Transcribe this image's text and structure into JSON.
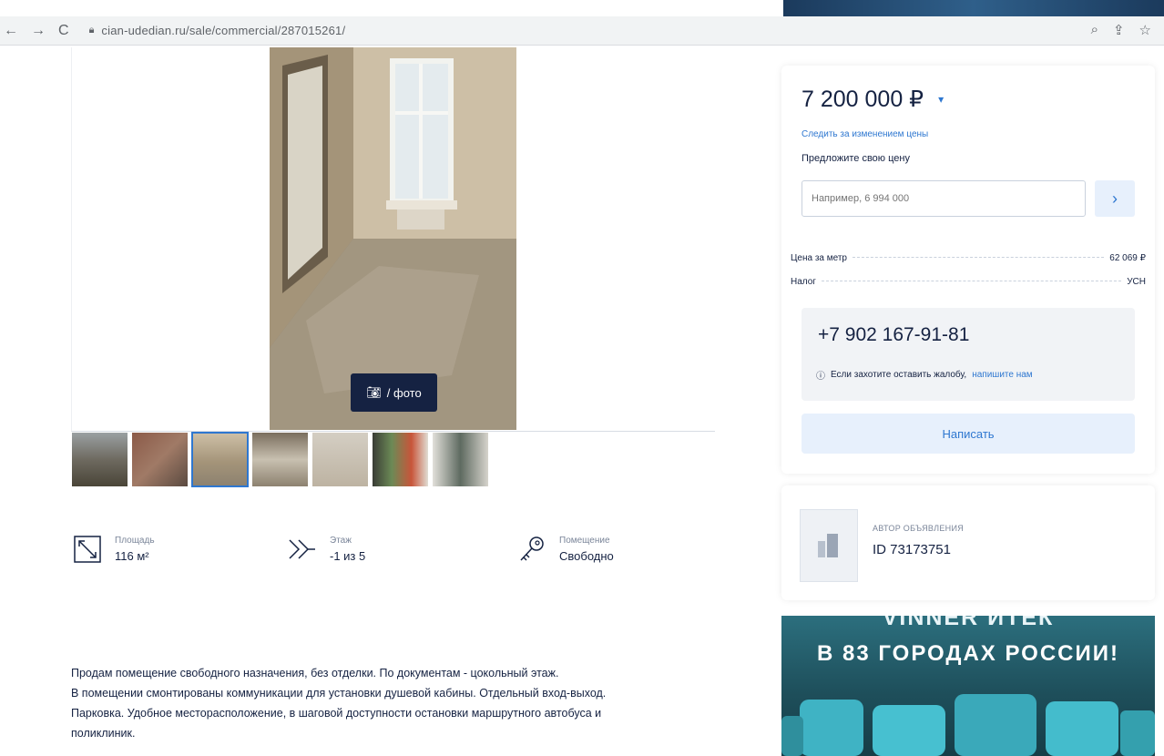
{
  "browser": {
    "url": "cian-udedian.ru/sale/commercial/287015261/"
  },
  "photo": {
    "count_label": "/ фото"
  },
  "features": [
    {
      "label": "Площадь",
      "value": "116 м²",
      "icon": "area-icon"
    },
    {
      "label": "Этаж",
      "value": "-1 из 5",
      "icon": "stairs-icon"
    },
    {
      "label": "Помещение",
      "value": "Свободно",
      "icon": "key-icon"
    }
  ],
  "description": {
    "lines": [
      "Продам помещение свободного назначения, без отделки. По документам - цокольный этаж.",
      "В помещении смонтированы коммуникации для установки душевой кабины. Отдельный вход-выход.",
      "Парковка. Удобное месторасположение, в шаговой доступности остановки маршрутного автобуса и",
      "поликлиник."
    ]
  },
  "price_card": {
    "price": "7 200 000 ₽",
    "follow_link": "Следить за изменением цены",
    "offer_label": "Предложите свою цену",
    "offer_placeholder": "Например, 6 994 000",
    "price_per_meter_label": "Цена за метр",
    "price_per_meter_value": "62 069 ₽",
    "tax_label": "Налог",
    "tax_value": "УСН",
    "phone": "+7 902 167-91-81",
    "complaint_text": "Если захотите оставить жалобу,",
    "complaint_link": "напишите нам",
    "write_button": "Написать"
  },
  "author": {
    "label": "АВТОР ОБЪЯВЛЕНИЯ",
    "id": "ID 73173751"
  },
  "ad": {
    "line1": "VINNER ИТЕК",
    "line2": "В 83 ГОРОДАХ РОССИИ!"
  },
  "colors": {
    "accent": "#2e77d0",
    "text": "#152242",
    "button_bg": "#e7f0fc"
  }
}
